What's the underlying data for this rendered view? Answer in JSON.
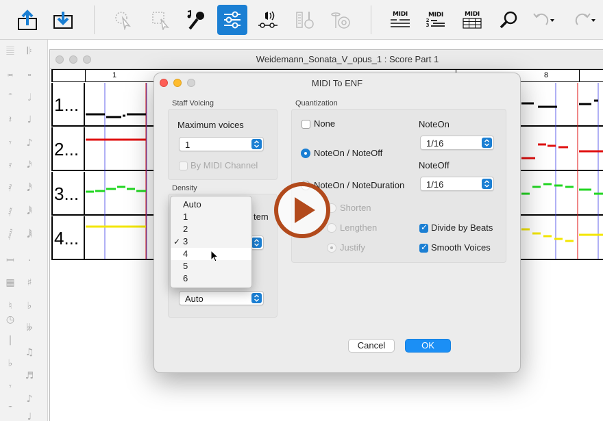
{
  "toolbar": {
    "midi_text": "MIDI",
    "midi_sub_2": "2",
    "midi_sub_3": "3"
  },
  "score_window": {
    "title": "Weidemann_Sonata_V_opus_1 : Score Part  1",
    "ruler": [
      "1",
      "8"
    ],
    "staves": [
      "1...",
      "2...",
      "3...",
      "4..."
    ],
    "colors": {
      "staff1": "#000000",
      "staff2": "#e01010",
      "staff3": "#22d622",
      "staff4": "#f3e600"
    }
  },
  "dialog": {
    "title": "MIDI To ENF",
    "staff_voicing": {
      "section": "Staff Voicing",
      "max_voices_label": "Maximum voices",
      "max_voices_value": "1",
      "by_midi_channel": "By MIDI Channel"
    },
    "density": {
      "section": "Density",
      "partial_label": "tem",
      "selected_value": "3",
      "second_popup_value": "Auto"
    },
    "quantization": {
      "section": "Quantization",
      "none": "None",
      "noteon_noteoff": "NoteOn / NoteOff",
      "noteon_noteduration": "NoteOn / NoteDuration",
      "shorten": "Shorten",
      "lengthen": "Lengthen",
      "justify": "Justify",
      "noteon_label": "NoteOn",
      "noteon_value": "1/16",
      "noteoff_label": "NoteOff",
      "noteoff_value": "1/16",
      "divide_by_beats": "Divide by Beats",
      "smooth_voices": "Smooth Voices"
    },
    "buttons": {
      "cancel": "Cancel",
      "ok": "OK"
    },
    "accent_color": "#1b7fd3"
  },
  "density_menu": {
    "options": [
      "Auto",
      "1",
      "2",
      "3",
      "4",
      "5",
      "6"
    ],
    "checked": "3",
    "hovered": "4",
    "check_glyph": "✓"
  },
  "overlay": {
    "icon": "play-icon",
    "color": "#b24a1c"
  }
}
